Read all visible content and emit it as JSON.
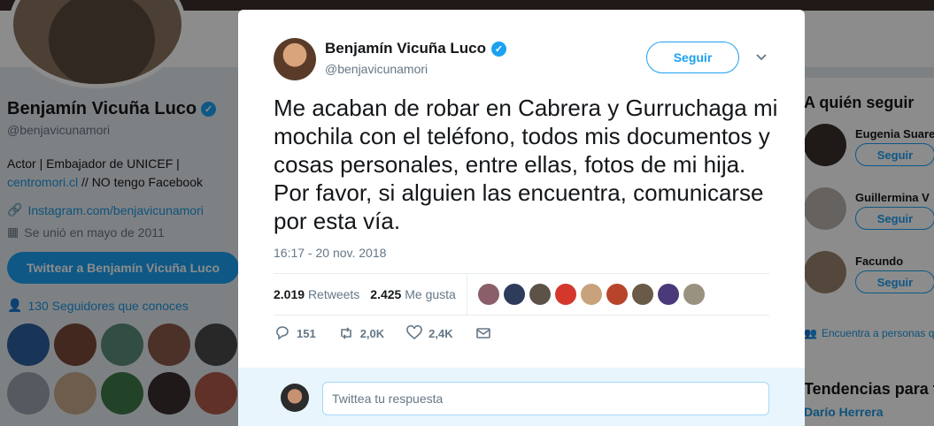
{
  "colors": {
    "accent": "#1da1f2",
    "link": "#1b95e0",
    "muted": "#657786"
  },
  "profile": {
    "name": "Benjamín Vicuña Luco",
    "handle": "@benjavicunamori",
    "bio_line1": "Actor | Embajador de UNICEF |",
    "bio_link": "centromori.cl",
    "bio_rest": " // NO tengo Facebook",
    "website": "Instagram.com/benjavicunamori",
    "joined": "Se unió en mayo de 2011",
    "tweet_to_label": "Twittear a Benjamín Vicuña Luco",
    "followers_you_know": "130 Seguidores que conoces"
  },
  "sidebar": {
    "who_to_follow_title": "A quién seguir",
    "suggestions": [
      {
        "name": "Eugenia Suare",
        "button": "Seguir"
      },
      {
        "name": "Guillermina V",
        "button": "Seguir"
      },
      {
        "name": "Facundo",
        "button": "Seguir"
      }
    ],
    "find_people": "Encuentra a personas q",
    "trends_title": "Tendencias para t",
    "trend_1": "Darío Herrera"
  },
  "tweet": {
    "author_name": "Benjamín Vicuña Luco",
    "author_handle": "@benjavicunamori",
    "follow_label": "Seguir",
    "text": "Me acaban de robar en Cabrera y Gurruchaga mi mochila con el teléfono, todos mis documentos y cosas personales, entre ellas, fotos de mi hija. Por favor, si alguien las encuentra, comunicarse por esta vía.",
    "timestamp": "16:17 - 20 nov. 2018",
    "retweets_count": "2.019",
    "retweets_label": "Retweets",
    "likes_count": "2.425",
    "likes_label": "Me gusta",
    "reply_count": "151",
    "retweet_action_count": "2,0K",
    "like_action_count": "2,4K",
    "reply_placeholder": "Twittea tu respuesta"
  }
}
